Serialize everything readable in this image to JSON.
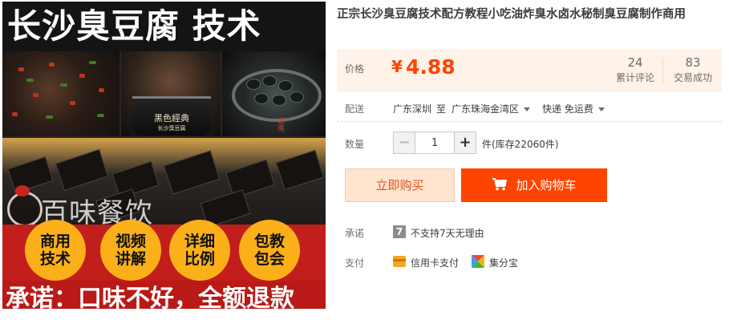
{
  "promo": {
    "headline": "长沙臭豆腐 技术",
    "pot_brand": "黑色經典",
    "pot_subbrand": "长沙臭豆腐",
    "photo_mark": "湖南",
    "brand": "百味餐饮",
    "badges": [
      "商用技术",
      "视频讲解",
      "详细比例",
      "包教包会"
    ],
    "promise": "承诺：口味不好，全额退款"
  },
  "product": {
    "title": "正宗长沙臭豆腐技术配方教程小吃油炸臭水卤水秘制臭豆腐制作商用"
  },
  "price": {
    "label": "价格",
    "symbol": "¥",
    "value": "4.88",
    "reviews_count": "24",
    "reviews_label": "累计评论",
    "sales_count": "83",
    "sales_label": "交易成功"
  },
  "shipping": {
    "label": "配送",
    "from": "广东深圳",
    "to_word": "至",
    "to": "广东珠海金湾区",
    "method": "快递 免运费"
  },
  "quantity": {
    "label": "数量",
    "minus": "−",
    "plus": "+",
    "value": "1",
    "stock": "件(库存22060件)"
  },
  "actions": {
    "buy_now": "立即购买",
    "add_to_cart": "加入购物车"
  },
  "promise_row": {
    "label": "承诺",
    "icon_text": "7",
    "text": "不支持7天无理由"
  },
  "payment": {
    "label": "支付",
    "credit_card": "信用卡支付",
    "jifenbao": "集分宝"
  },
  "colors": {
    "accent": "#ff4400",
    "price": "#ff4400",
    "price_bg": "#fff2e8",
    "buy_now_bg": "#ffe4d0"
  }
}
